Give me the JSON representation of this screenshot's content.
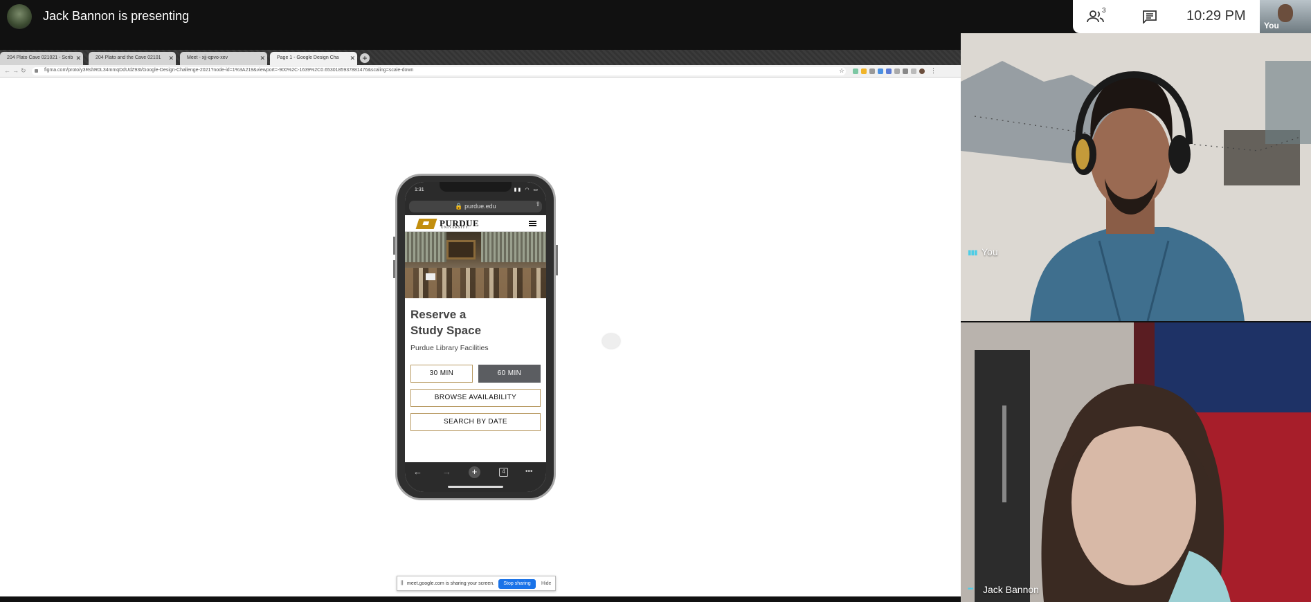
{
  "meeting": {
    "presenting_text": "Jack Bannon is presenting",
    "participants_count": "3",
    "clock": "10:29 PM",
    "self_label": "You"
  },
  "browser": {
    "tabs": [
      {
        "label": "204 Plato Cave 021021 - Scrib"
      },
      {
        "label": "204 Plato and the Cave 02101"
      },
      {
        "label": "Meet - xjj-qpvo-xev"
      },
      {
        "label": "Page 1 - Google Design Cha"
      }
    ],
    "url": "figma.com/proto/y3RshR0L34mmqDdUdZ93t/Google-Design-Challenge-2021?node-id=1%3A219&viewport=-900%2C-1639%2C0.6530185937881476&scaling=scale-down"
  },
  "phone": {
    "status_time": "1:31",
    "status_icons": "▮▮ ◠ ▭",
    "safari_url": "🔒 purdue.edu",
    "logo_word": "PURDUE",
    "logo_sub": "UNIVERSITY.",
    "title_line1": "Reserve a",
    "title_line2": "Study Space",
    "subtitle": "Purdue Library Facilities",
    "buttons": {
      "min30": "30 MIN",
      "min60": "60 MIN",
      "browse": "BROWSE AVAILABILITY",
      "search": "SEARCH BY DATE"
    },
    "bottom_bar": {
      "back": "←",
      "forward": "→",
      "new_tab": "+",
      "tabs_count": "4",
      "more": "•••"
    }
  },
  "share_notice": {
    "text": "meet.google.com is sharing your screen.",
    "stop_label": "Stop sharing",
    "hide_label": "Hide"
  },
  "tiles": {
    "you_label": "You",
    "jack_label": "Jack Bannon"
  },
  "colors": {
    "purdue_gold": "#c28e0e",
    "meet_blue": "#1a73e8",
    "speaking": "#4ecde6"
  }
}
